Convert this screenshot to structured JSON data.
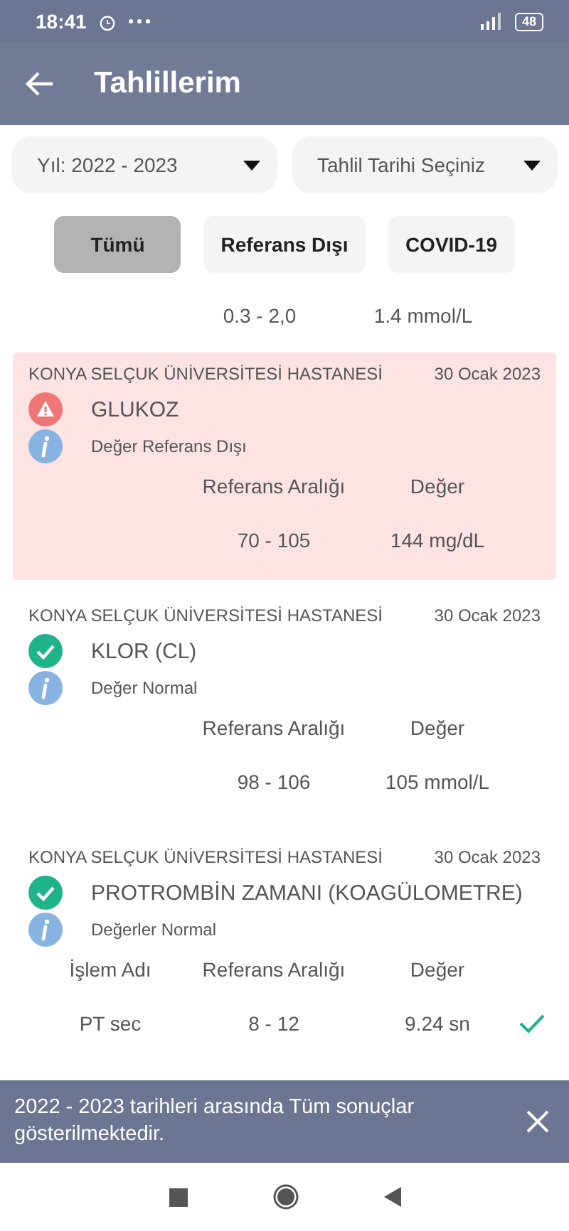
{
  "status_bar": {
    "time": "18:41",
    "battery": "48"
  },
  "header": {
    "title": "Tahlillerim"
  },
  "filters": [
    {
      "label": "Yıl: 2022 - 2023"
    },
    {
      "label": "Tahlil Tarihi Seçiniz"
    }
  ],
  "chips": [
    {
      "label": "Tümü",
      "selected": true
    },
    {
      "label": "Referans Dışı",
      "selected": false
    },
    {
      "label": "COVID-19",
      "selected": false
    }
  ],
  "partial_row": {
    "range": "0.3 - 2,0",
    "value": "1.4  mmol/L"
  },
  "results": [
    {
      "hospital": "KONYA SELÇUK ÜNİVERSİTESİ  HASTANESİ",
      "date": "30 Ocak 2023",
      "name": "GLUKOZ",
      "out_of_range": true,
      "note": "Değer Referans Dışı",
      "headers": [
        "Referans Aralığı",
        "Değer"
      ],
      "rows": [
        {
          "range": "70 - 105",
          "value": "144 mg/dL"
        }
      ]
    },
    {
      "hospital": "KONYA SELÇUK ÜNİVERSİTESİ  HASTANESİ",
      "date": "30 Ocak 2023",
      "name": "KLOR (CL)",
      "out_of_range": false,
      "note": "Değer Normal",
      "headers": [
        "Referans Aralığı",
        "Değer"
      ],
      "rows": [
        {
          "range": "98 - 106",
          "value": "105  mmol/L"
        }
      ]
    },
    {
      "hospital": "KONYA SELÇUK ÜNİVERSİTESİ  HASTANESİ",
      "date": "30 Ocak 2023",
      "name": "PROTROMBİN ZAMANI (KOAGÜLOMETRE)",
      "out_of_range": false,
      "note": "Değerler Normal",
      "headers": [
        "İşlem Adı",
        "Referans Aralığı",
        "Değer"
      ],
      "rows": [
        {
          "item": "PT sec",
          "range": "8 - 12",
          "value": "9.24  sn",
          "ok": true
        }
      ]
    }
  ],
  "snackbar": {
    "message": "2022 - 2023 tarihleri arasında Tüm sonuçlar gösterilmektedir."
  }
}
